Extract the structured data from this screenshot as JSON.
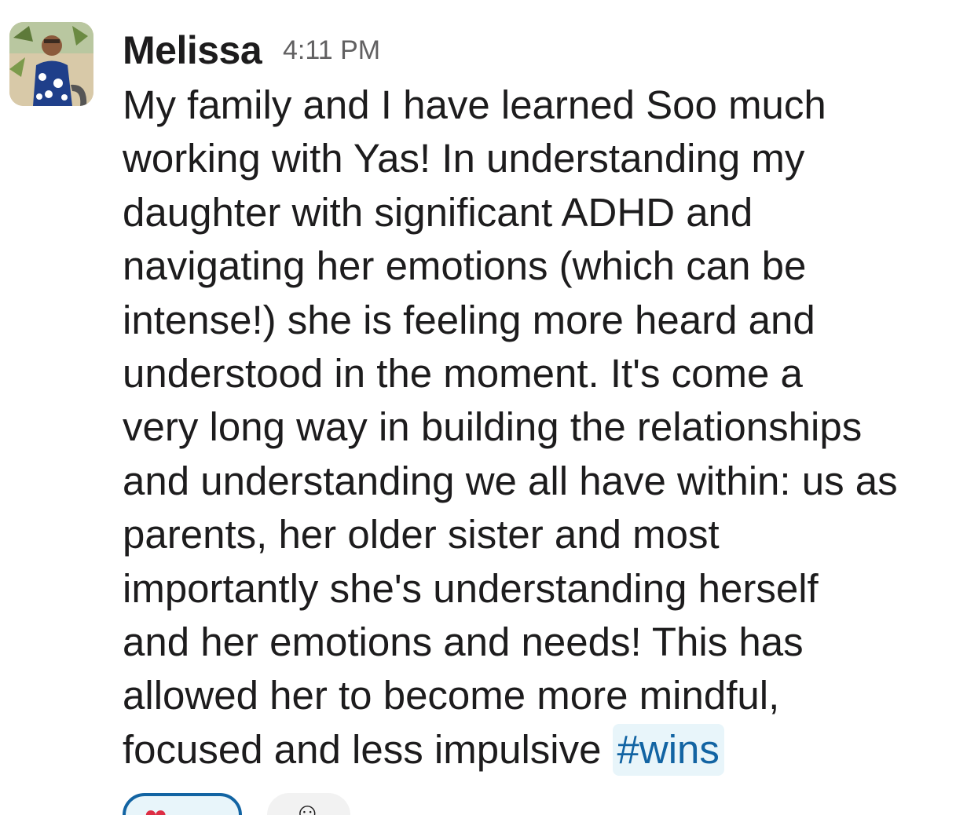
{
  "message": {
    "sender": "Melissa",
    "timestamp": "4:11 PM",
    "avatar_icon": "user-photo-avatar",
    "lines": [
      "My family and I have learned Soo much",
      "working with Yas! In understanding my",
      "daughter with significant ADHD and",
      "navigating her emotions (which can be",
      "intense!) she is feeling more heard and",
      "understood in the moment. It's come a",
      "very long way in building the relationships",
      "and understanding we all have within: us as",
      "parents, her older sister and most",
      "importantly she's understanding herself",
      "and her emotions and needs! This has",
      "allowed her to become more mindful,",
      "focused and less impulsive"
    ],
    "hashtag": "#wins"
  },
  "reactions": {
    "items": [
      {
        "emoji": "❤",
        "icon": "heart-reaction-icon"
      }
    ],
    "add_reaction_icon": "add-emoji-icon"
  },
  "colors": {
    "text": "#1d1c1d",
    "timestamp": "#616061",
    "hashtag_text": "#1264a3",
    "hashtag_bg": "#e8f5fa",
    "reaction_border": "#1264a3"
  }
}
